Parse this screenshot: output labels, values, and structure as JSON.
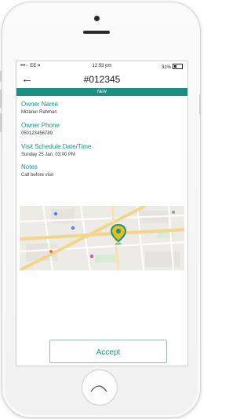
{
  "status_bar": {
    "signal": "•••◦◦ EE ⌗",
    "time": "12:53 pm",
    "battery_text": "31%",
    "battery_level": 0.31
  },
  "header": {
    "back_icon": "←",
    "title": "#012345"
  },
  "banner": {
    "label": "NEW"
  },
  "owner_name": {
    "label": "Owner Name",
    "value": "Mizanur Rahman"
  },
  "owner_phone": {
    "label": "Owner Phone",
    "value": "050123456789"
  },
  "visit": {
    "label": "Visit Schedule Date/Time",
    "value": "Sunday  25  Jan,  03:00 PM"
  },
  "notes": {
    "label": "Notes",
    "value": "Call before visit"
  },
  "map": {
    "pin_color": "#e3c01c",
    "pin_icon": "location-pin-icon"
  },
  "accept_button": {
    "label": "Accept"
  },
  "colors": {
    "accent": "#1a9085"
  }
}
